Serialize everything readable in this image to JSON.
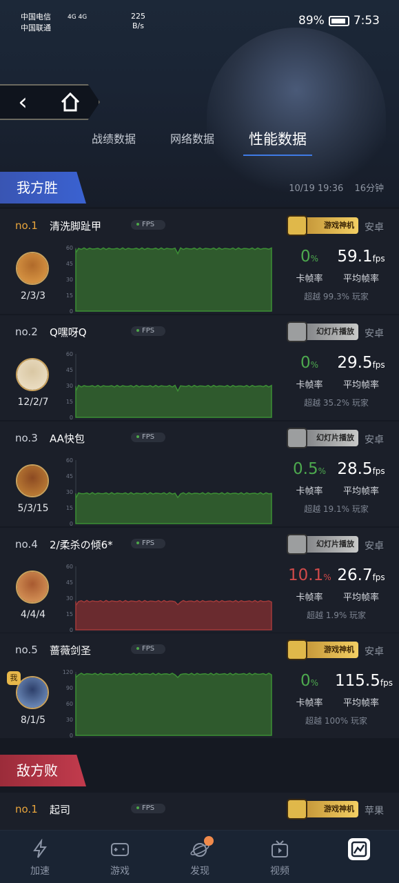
{
  "status_bar": {
    "carrier1": "中国电信",
    "carrier2": "中国联通",
    "net": "4G 4G",
    "speed_value": "225",
    "speed_unit": "B/s",
    "battery": "89%",
    "time": "7:53"
  },
  "nav": {
    "tabs": [
      "战绩数据",
      "网络数据",
      "性能数据"
    ],
    "active_tab": "性能数据"
  },
  "team_win": {
    "label": "我方胜",
    "date": "10/19 19:36",
    "duration": "16分钟"
  },
  "fps_tag": "FPS",
  "labels": {
    "stutter": "卡帧率",
    "avg": "平均帧率",
    "fps_unit": "fps",
    "pct_unit": "%"
  },
  "players": [
    {
      "rank": "no.1",
      "name": "清洗脚趾甲",
      "badge": "游戏神机",
      "badge_type": "god",
      "platform": "安卓",
      "kda": "2/3/3",
      "stutter": "0",
      "stutter_color": "green",
      "avg_fps": "59.1",
      "beat": "超越 99.3% 玩家",
      "y_max": 60,
      "ticks": [
        60,
        45,
        30,
        15,
        0
      ],
      "level": 59,
      "color": "#3c8f35",
      "fill": "#2f5a2d"
    },
    {
      "rank": "no.2",
      "name": "Q嘿呀Q",
      "badge": "幻灯片播放",
      "badge_type": "slide",
      "platform": "安卓",
      "kda": "12/2/7",
      "stutter": "0",
      "stutter_color": "green",
      "avg_fps": "29.5",
      "beat": "超越 35.2% 玩家",
      "y_max": 60,
      "ticks": [
        60,
        45,
        30,
        15,
        0
      ],
      "level": 29.5,
      "color": "#3c8f35",
      "fill": "#2f5a2d"
    },
    {
      "rank": "no.3",
      "name": "AA快包",
      "badge": "幻灯片播放",
      "badge_type": "slide",
      "platform": "安卓",
      "kda": "5/3/15",
      "stutter": "0.5",
      "stutter_color": "green",
      "avg_fps": "28.5",
      "beat": "超越 19.1% 玩家",
      "y_max": 60,
      "ticks": [
        60,
        45,
        30,
        15,
        0
      ],
      "level": 28.5,
      "color": "#3c8f35",
      "fill": "#2f5a2d"
    },
    {
      "rank": "no.4",
      "name": "2/柔杀の倾6*",
      "badge": "幻灯片播放",
      "badge_type": "slide",
      "platform": "安卓",
      "kda": "4/4/4",
      "stutter": "10.1",
      "stutter_color": "red",
      "avg_fps": "26.7",
      "beat": "超越 1.9% 玩家",
      "y_max": 60,
      "ticks": [
        60,
        45,
        30,
        15,
        0
      ],
      "level": 27,
      "color": "#a33a3a",
      "fill": "#6a2b2f"
    },
    {
      "rank": "no.5",
      "name": "蔷薇剑圣",
      "badge": "游戏神机",
      "badge_type": "god",
      "platform": "安卓",
      "kda": "8/1/5",
      "stutter": "0",
      "stutter_color": "green",
      "avg_fps": "115.5",
      "beat": "超越 100% 玩家",
      "y_max": 120,
      "ticks": [
        120,
        90,
        60,
        30,
        0
      ],
      "level": 116,
      "color": "#3c8f35",
      "fill": "#2f5a2d",
      "me": "我"
    }
  ],
  "team_lose": {
    "label": "敌方败"
  },
  "enemy_first": {
    "rank": "no.1",
    "name": "起司",
    "badge": "游戏神机",
    "platform": "苹果"
  },
  "bottom_nav": [
    "加速",
    "游戏",
    "发现",
    "视频",
    ""
  ]
}
